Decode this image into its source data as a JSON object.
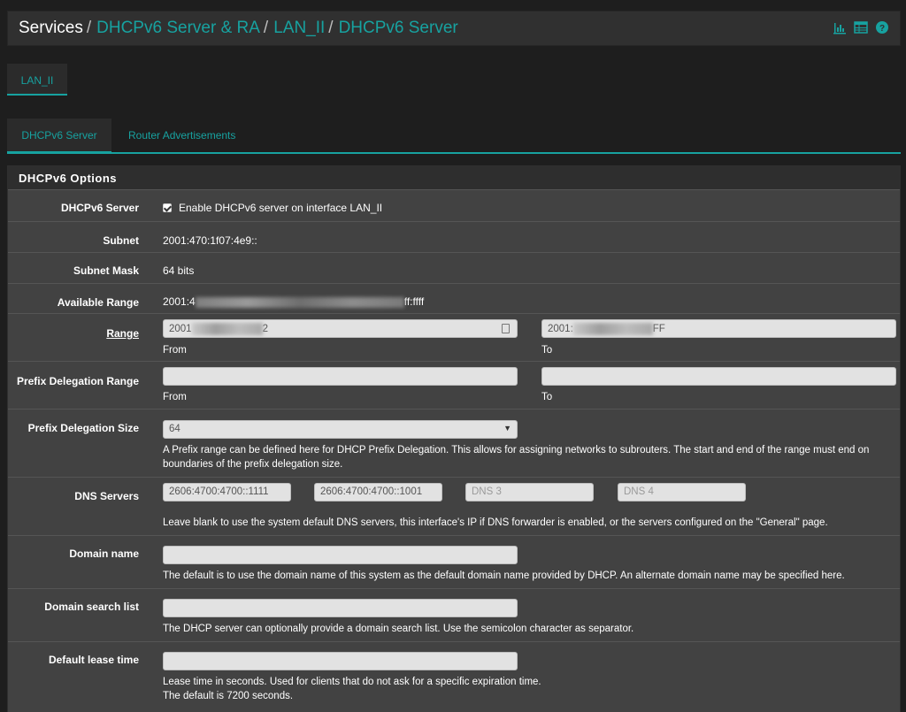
{
  "breadcrumb": {
    "root": "Services",
    "item1": "DHCPv6 Server & RA",
    "item2": "LAN_II",
    "item3": "DHCPv6 Server",
    "sep": "/"
  },
  "header_icons": [
    "bar-chart-icon",
    "table-icon",
    "help-icon"
  ],
  "interface_tab": "LAN_II",
  "subtabs": {
    "active": "DHCPv6 Server",
    "other": "Router Advertisements"
  },
  "panel": {
    "title": "DHCPv6 Options",
    "enable": {
      "label": "DHCPv6 Server",
      "text": "Enable DHCPv6 server on interface LAN_II",
      "checked": true
    },
    "subnet": {
      "label": "Subnet",
      "value": "2001:470:1f07:4e9::"
    },
    "subnet_mask": {
      "label": "Subnet Mask",
      "value": "64 bits"
    },
    "available_range": {
      "label": "Available Range",
      "prefix": "2001:4",
      "suffix": "ff:ffff"
    },
    "range": {
      "label": "Range",
      "from_prefix": "2001",
      "from_suffix": "2",
      "to_prefix": "2001:",
      "to_suffix": "FF",
      "from_label": "From",
      "to_label": "To"
    },
    "pd_range": {
      "label": "Prefix Delegation Range",
      "from_label": "From",
      "to_label": "To"
    },
    "pd_size": {
      "label": "Prefix Delegation Size",
      "value": "64",
      "help": "A Prefix range can be defined here for DHCP Prefix Delegation. This allows for assigning networks to subrouters. The start and end of the range must end on boundaries of the prefix delegation size."
    },
    "dns": {
      "label": "DNS Servers",
      "dns1": "2606:4700:4700::1111",
      "dns2": "2606:4700:4700::1001",
      "dns3_placeholder": "DNS 3",
      "dns4_placeholder": "DNS 4",
      "help": "Leave blank to use the system default DNS servers, this interface's IP if DNS forwarder is enabled, or the servers configured on the \"General\" page."
    },
    "domain": {
      "label": "Domain name",
      "help": "The default is to use the domain name of this system as the default domain name provided by DHCP. An alternate domain name may be specified here."
    },
    "search": {
      "label": "Domain search list",
      "help": "The DHCP server can optionally provide a domain search list. Use the semicolon character as separator."
    },
    "lease": {
      "label": "Default lease time",
      "help1": "Lease time in seconds. Used for clients that do not ask for a specific expiration time.",
      "help2": "The default is 7200 seconds."
    }
  }
}
